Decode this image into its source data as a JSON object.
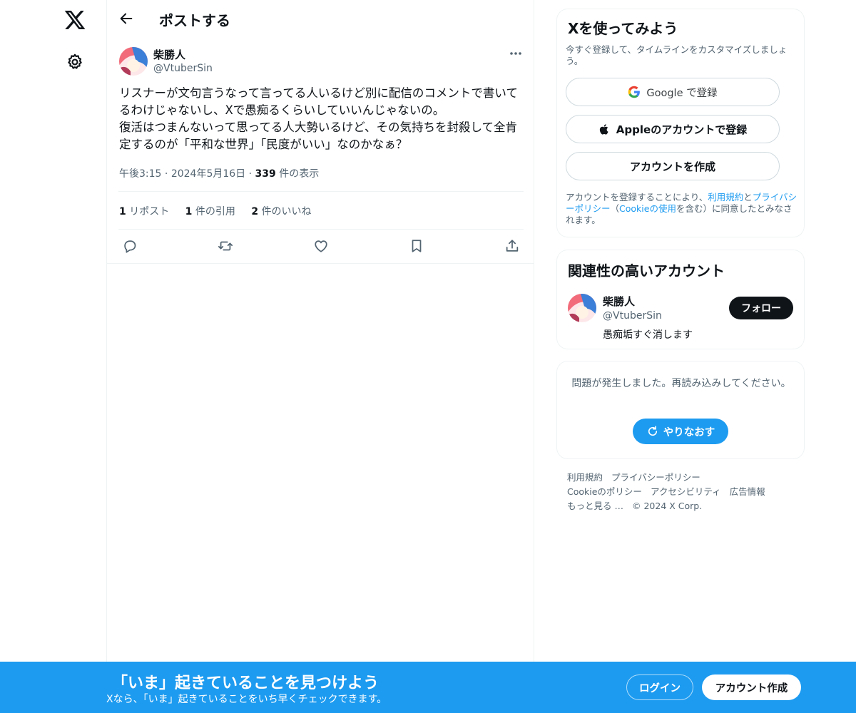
{
  "header": {
    "title": "ポストする"
  },
  "tweet": {
    "author_name": "柴勝人",
    "author_handle": "@VtuberSin",
    "text": "リスナーが文句言うなって言ってる人いるけど別に配信のコメントで書いてるわけじゃないし、Xで愚痴るくらいしていいんじゃないの。\n復活はつまんないって思ってる人大勢いるけど、その気持ちを封殺して全肯定するのが「平和な世界」「民度がいい」なのかなぁ？",
    "time": "午後3:15",
    "date": "2024年5月16日",
    "views_count": "339",
    "views_label": "件の表示",
    "stats": [
      {
        "count": "1",
        "label": "リポスト"
      },
      {
        "count": "1",
        "label": "件の引用"
      },
      {
        "count": "2",
        "label": "件のいいね"
      }
    ]
  },
  "signup": {
    "title": "Xを使ってみよう",
    "subtitle": "今すぐ登録して、タイムラインをカスタマイズしましょう。",
    "google_label": "Google で登録",
    "apple_label": "Appleのアカウントで登録",
    "create_label": "アカウントを作成",
    "terms_pre": "アカウントを登録することにより、",
    "terms_link1": "利用規約",
    "terms_and": "と",
    "terms_link2": "プライバシーポリシー",
    "terms_mid": "（",
    "terms_link3": "Cookieの使用",
    "terms_post": "を含む）に同意したとみなされます。"
  },
  "related": {
    "title": "関連性の高いアカウント",
    "name": "柴勝人",
    "handle": "@VtuberSin",
    "bio": "愚痴垢すぐ消します",
    "follow_label": "フォロー"
  },
  "error": {
    "message": "問題が発生しました。再読み込みしてください。",
    "retry_label": "やりなおす"
  },
  "footer": {
    "links": [
      "利用規約",
      "プライバシーポリシー",
      "Cookieのポリシー",
      "アクセシビリティ",
      "広告情報",
      "もっと見る …"
    ],
    "copyright": "© 2024 X Corp."
  },
  "banner": {
    "title": "「いま」起きていることを見つけよう",
    "subtitle": "Xなら、「いま」起きていることをいち早くチェックできます。",
    "login_label": "ログイン",
    "create_label": "アカウント作成"
  },
  "colors": {
    "accent": "#1d9bf0",
    "text": "#0f1419",
    "muted": "#536471",
    "border": "#eff3f4"
  },
  "icons": [
    "x-logo-icon",
    "gear-icon",
    "back-arrow-icon",
    "more-icon",
    "reply-icon",
    "repost-icon",
    "like-icon",
    "bookmark-icon",
    "share-icon",
    "google-icon",
    "apple-icon",
    "refresh-icon"
  ]
}
